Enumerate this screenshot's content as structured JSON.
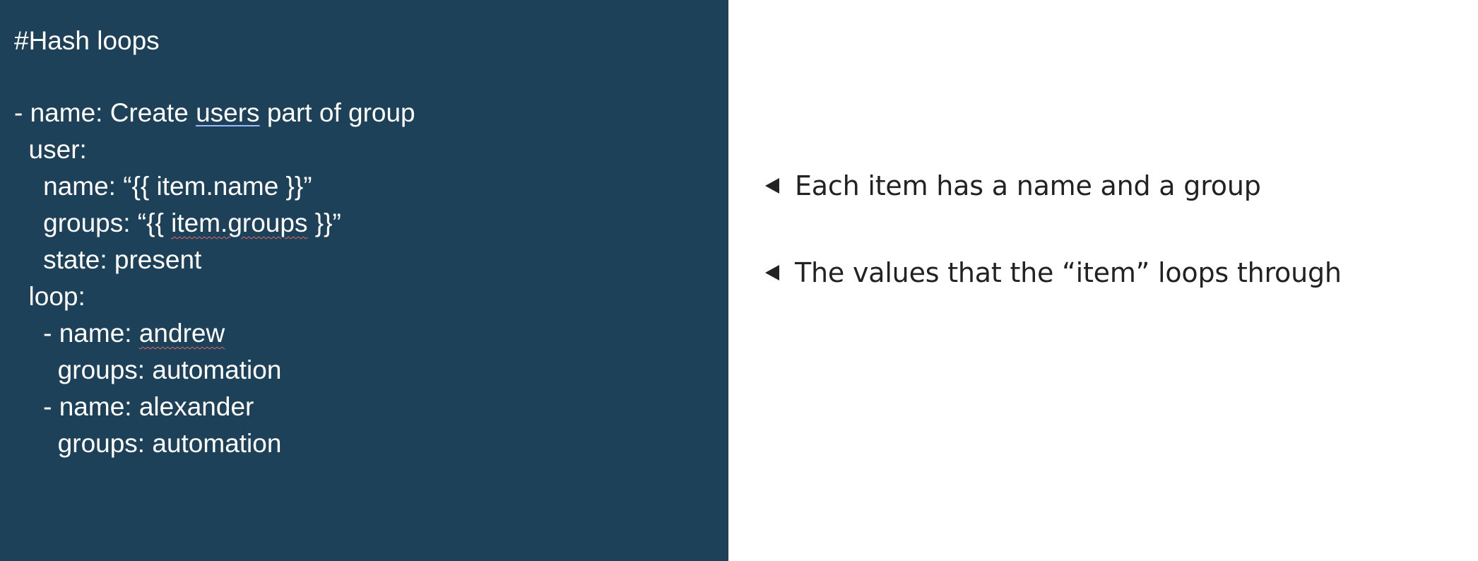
{
  "code": {
    "lines": [
      {
        "text": "#Hash loops"
      },
      {
        "text": ""
      },
      {
        "pre": "- name: Create ",
        "u": "users",
        "post": " part of group"
      },
      {
        "text": "  user:"
      },
      {
        "text": "    name: “{{ item.name }}”"
      },
      {
        "pre": "    groups: “{{ ",
        "u": "item.groups",
        "post": " }}”"
      },
      {
        "text": "    state: present"
      },
      {
        "text": "  loop:"
      },
      {
        "pre": "    - name: ",
        "u": "andrew",
        "post": ""
      },
      {
        "text": "      groups: automation"
      },
      {
        "text": "    - name: alexander"
      },
      {
        "text": "      groups: automation"
      }
    ]
  },
  "notes": [
    {
      "text": "Each item has a name and a group"
    },
    {
      "text": "The values that the “item” loops through"
    }
  ],
  "colors": {
    "code_background": "#1d4158",
    "code_text": "#ffffff",
    "note_text": "#222222",
    "spell_underline": "#e06a6a",
    "link_underline": "#9db8ff"
  },
  "icons": {
    "note_bullet": "left-triangle-arrow"
  }
}
